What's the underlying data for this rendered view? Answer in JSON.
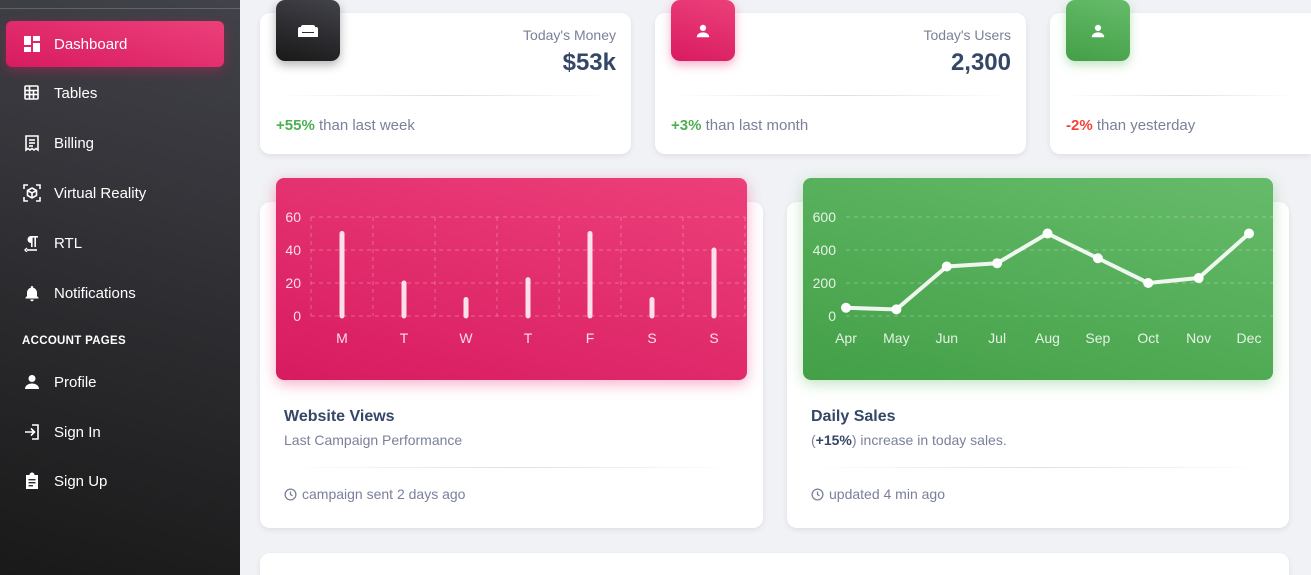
{
  "sidebar": {
    "items": [
      {
        "label": "Dashboard",
        "icon": "dashboard-icon",
        "active": true
      },
      {
        "label": "Tables",
        "icon": "table-icon"
      },
      {
        "label": "Billing",
        "icon": "receipt-icon"
      },
      {
        "label": "Virtual Reality",
        "icon": "view-in-ar-icon"
      },
      {
        "label": "RTL",
        "icon": "format-textdirection-icon"
      },
      {
        "label": "Notifications",
        "icon": "bell-icon"
      }
    ],
    "section_title": "ACCOUNT PAGES",
    "account_items": [
      {
        "label": "Profile",
        "icon": "person-icon"
      },
      {
        "label": "Sign In",
        "icon": "login-icon"
      },
      {
        "label": "Sign Up",
        "icon": "assignment-icon"
      }
    ]
  },
  "stats": [
    {
      "label": "Today's Money",
      "value": "$53k",
      "change": "+55%",
      "change_text": " than last week",
      "trend": "up",
      "icon": "weekend-icon",
      "color": "#262626"
    },
    {
      "label": "Today's Users",
      "value": "2,300",
      "change": "+3%",
      "change_text": " than last month",
      "trend": "up",
      "icon": "person-icon",
      "color": "#e91e63"
    },
    {
      "label": "",
      "value": "",
      "change": "-2%",
      "change_text": " than yesterday",
      "trend": "down",
      "icon": "person-icon",
      "color": "#4caf50"
    }
  ],
  "charts": {
    "website_views": {
      "title": "Website Views",
      "subtitle": "Last Campaign Performance",
      "footer": "campaign sent 2 days ago"
    },
    "daily_sales": {
      "title": "Daily Sales",
      "subtitle_prefix": "(",
      "subtitle_bold": "+15%",
      "subtitle_suffix": ") increase in today sales.",
      "footer": "updated 4 min ago"
    }
  },
  "chart_data": [
    {
      "type": "bar",
      "categories": [
        "M",
        "T",
        "W",
        "T",
        "F",
        "S",
        "S"
      ],
      "values": [
        50,
        20,
        10,
        22,
        50,
        10,
        40
      ],
      "ylim": [
        0,
        60
      ],
      "yticks": [
        0,
        20,
        40,
        60
      ],
      "color": "#e91e63"
    },
    {
      "type": "line",
      "categories": [
        "Apr",
        "May",
        "Jun",
        "Jul",
        "Aug",
        "Sep",
        "Oct",
        "Nov",
        "Dec"
      ],
      "values": [
        50,
        40,
        300,
        320,
        500,
        350,
        200,
        230,
        500
      ],
      "ylim": [
        0,
        600
      ],
      "yticks": [
        0,
        200,
        400,
        600
      ],
      "color": "#4caf50"
    }
  ]
}
